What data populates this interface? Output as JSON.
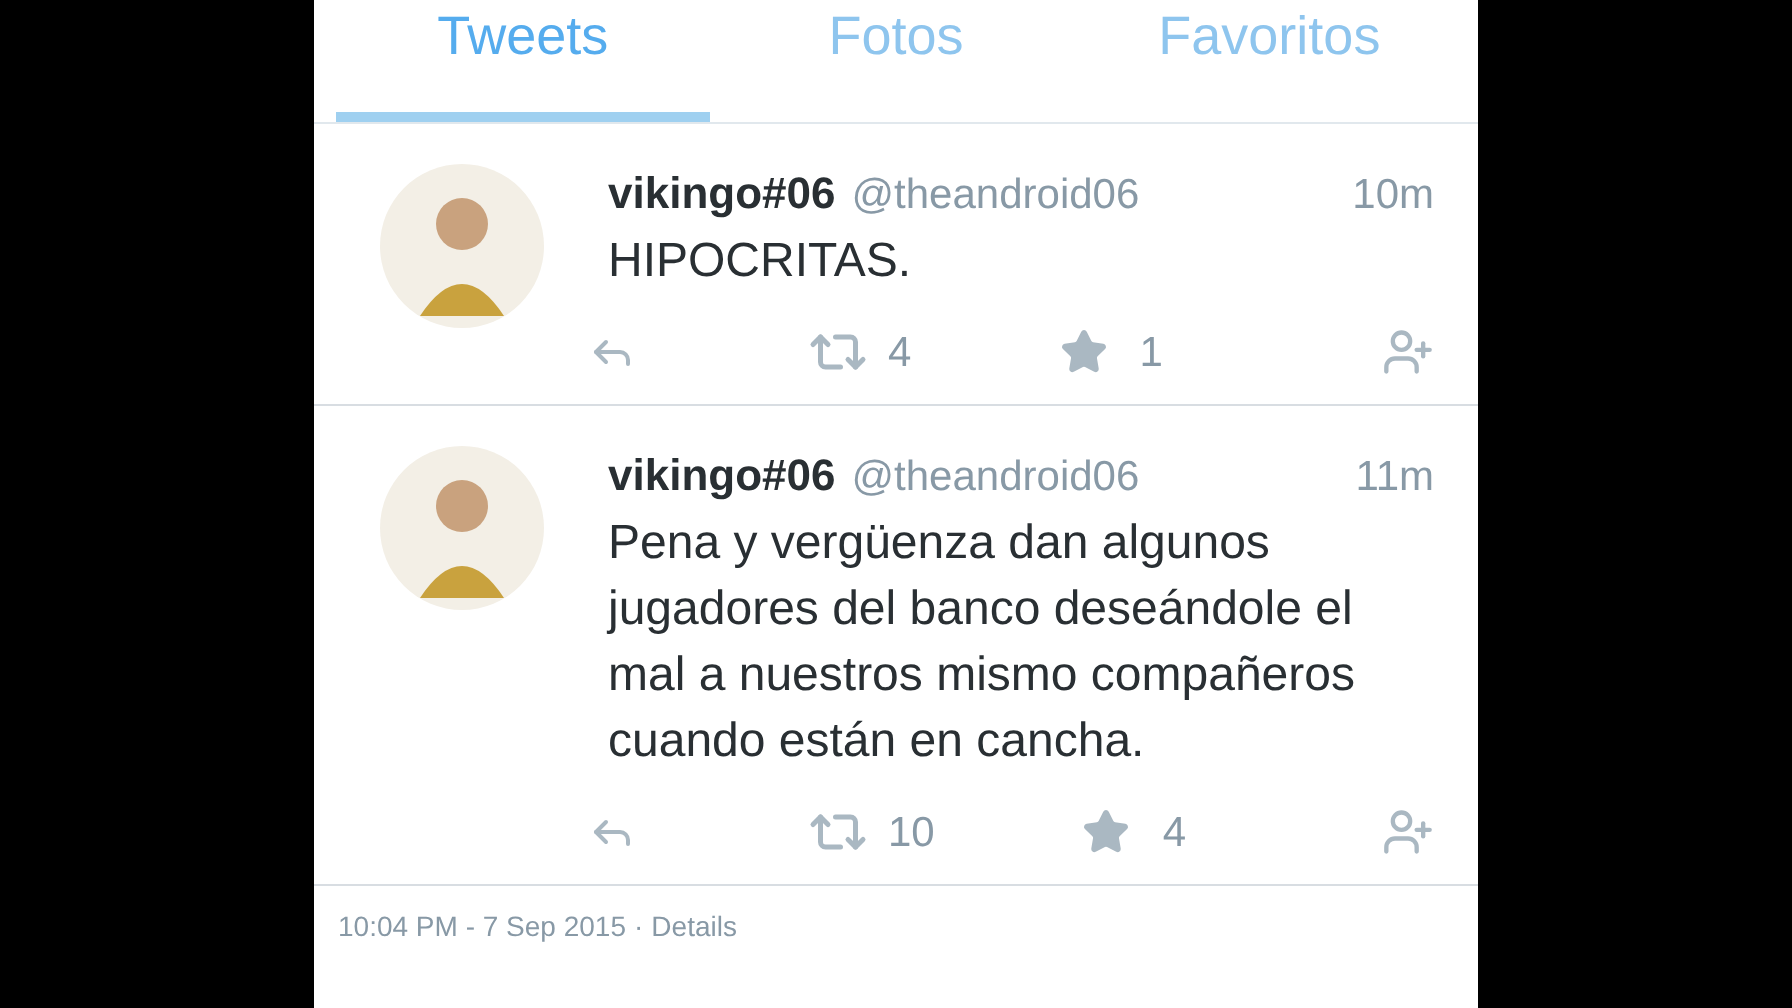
{
  "tabs": [
    {
      "label": "Tweets",
      "selected": true
    },
    {
      "label": "Fotos",
      "selected": false
    },
    {
      "label": "Favoritos",
      "selected": false
    }
  ],
  "tweets": [
    {
      "name": "vikingo#06",
      "handle": "@theandroid06",
      "time": "10m",
      "text": "HIPOCRITAS.",
      "retweets": "4",
      "favorites": "1"
    },
    {
      "name": "vikingo#06",
      "handle": "@theandroid06",
      "time": "11m",
      "text": "Pena y vergüenza dan algunos jugadores del banco deseándole el mal a nuestros mismo compañeros cuando están en cancha.",
      "retweets": "10",
      "favorites": "4"
    }
  ],
  "footer": {
    "timestamp": "10:04 PM - 7 Sep 2015",
    "separator": "·",
    "details": "Details"
  }
}
